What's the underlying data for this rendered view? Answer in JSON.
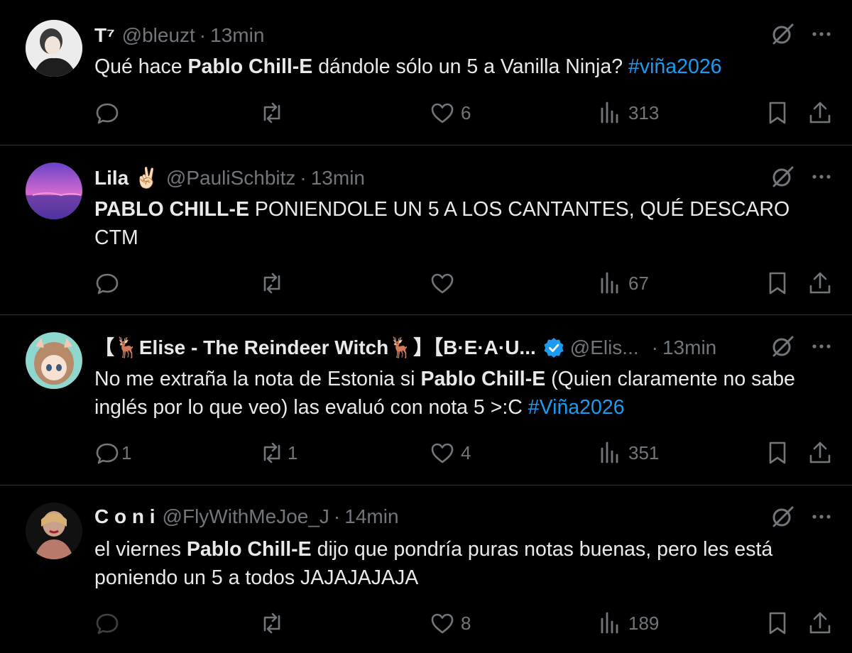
{
  "tweets": [
    {
      "name": "T⁷",
      "handle": "@bleuzt",
      "time": "13min",
      "text_parts": [
        {
          "t": "Qué hace ",
          "s": "n"
        },
        {
          "t": "Pablo Chill-E",
          "s": "b"
        },
        {
          "t": " dándole sólo un 5 a Vanilla Ninja? ",
          "s": "n"
        },
        {
          "t": "#viña2026",
          "s": "h"
        }
      ],
      "replies": "",
      "retweets": "",
      "likes": "6",
      "views": "313",
      "avatar_colors": [
        "#e9e9e9",
        "#222"
      ]
    },
    {
      "name": "Lila ✌🏻",
      "handle": "@PauliSchbitz",
      "time": "13min",
      "text_parts": [
        {
          "t": "PABLO CHILL-E",
          "s": "b"
        },
        {
          "t": " PONIENDOLE UN 5 A LOS CANTANTES, QUÉ DESCARO CTM",
          "s": "n"
        }
      ],
      "replies": "",
      "retweets": "",
      "likes": "",
      "views": "67",
      "avatar_colors": [
        "#7b4fd1",
        "#d86ad8"
      ]
    },
    {
      "name": "【🦌Elise - The Reindeer Witch🦌】【B·E·A·U...",
      "handle": "@Elis...",
      "time": "13min",
      "text_parts": [
        {
          "t": "No me extraña la nota de Estonia si ",
          "s": "n"
        },
        {
          "t": "Pablo Chill-E",
          "s": "b"
        },
        {
          "t": " (Quien claramente no sabe inglés por lo que veo) las evaluó con nota 5 >:C ",
          "s": "n"
        },
        {
          "t": "#Viña2026",
          "s": "h"
        }
      ],
      "replies": "1",
      "retweets": "1",
      "likes": "4",
      "views": "351",
      "avatar_colors": [
        "#8fd6cc",
        "#b78a6a"
      ]
    },
    {
      "name": "C o n i",
      "handle": "@FlyWithMeJoe_J",
      "time": "14min",
      "text_parts": [
        {
          "t": "el viernes ",
          "s": "n"
        },
        {
          "t": "Pablo Chill-E",
          "s": "b"
        },
        {
          "t": " dijo que pondría puras notas buenas, pero les está poniendo un 5 a todos JAJAJAJAJA",
          "s": "n"
        }
      ],
      "replies": "",
      "retweets": "",
      "likes": "8",
      "views": "189",
      "avatar_colors": [
        "#1a1a1a",
        "#c9a08a"
      ]
    }
  ],
  "colors": {
    "background": "#000000",
    "text": "#e7e9ea",
    "muted": "#71767b",
    "link": "#1d9bf0",
    "divider": "#2f3336",
    "verified": "#1d9bf0"
  }
}
